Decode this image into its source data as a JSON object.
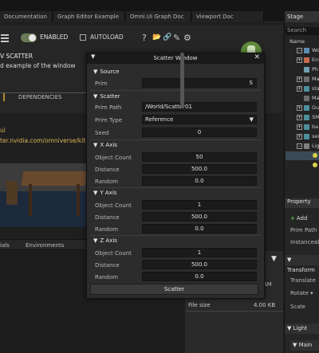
{
  "tabs": [
    {
      "label": "Documentation",
      "active": false
    },
    {
      "label": "Graph Editor Example",
      "active": false
    },
    {
      "label": "Omni.UI Graph Doc",
      "active": false
    },
    {
      "label": "Viewport Doc",
      "active": false
    },
    {
      "label": "Stage",
      "active": true
    }
  ],
  "toolbar": {
    "enabled_label": "ENABLED",
    "enabled_state": true,
    "autoload_label": "AUTOLOAD",
    "autoload_checked": false,
    "help_icon": "?",
    "folder_icon": "📂",
    "link_icon": "🔗",
    "edit_icon": "✎",
    "settings_icon": "⚙"
  },
  "extension": {
    "title": "V SCATTER",
    "description": "d example of the window",
    "dependencies_tab": "DEPENDENCIES",
    "pa_tab": "PA",
    "ui_label": "ui",
    "url": "ter.nvidia.com/omniverse/kit-ext"
  },
  "bottom_tabs": [
    "ials",
    "Environments"
  ],
  "file_info": {
    "label": "File size",
    "value": "4.00 KB",
    "am_label": "AM"
  },
  "stage": {
    "search": "Search",
    "column_name": "Name",
    "rows": [
      {
        "label": "World",
        "expander": "–",
        "icon_color": "#5a8db0",
        "selected": false
      },
      {
        "label": "Env",
        "expander": "+",
        "icon_color": "#c36c4e",
        "selected": false
      },
      {
        "label": "Ph",
        "expander": "",
        "icon_color": "#6fa0b0",
        "selected": false
      },
      {
        "label": "Ma",
        "expander": "+",
        "icon_color": "#6b6b6b",
        "selected": false
      },
      {
        "label": "sta",
        "expander": "+",
        "icon_color": "#4d8e9a",
        "selected": false
      },
      {
        "label": "Ma",
        "expander": "",
        "icon_color": "#6b6b6b",
        "selected": false
      },
      {
        "label": "Gu",
        "expander": "+",
        "icon_color": "#4d8e9a",
        "selected": false
      },
      {
        "label": "SM",
        "expander": "+",
        "icon_color": "#4d8e9a",
        "selected": false
      },
      {
        "label": "ba",
        "expander": "+",
        "icon_color": "#4d8e9a",
        "selected": false
      },
      {
        "label": "ser",
        "expander": "+",
        "icon_color": "#4d8e9a",
        "selected": false
      },
      {
        "label": "Lig",
        "expander": "–",
        "icon_color": "#7f7f7f",
        "selected": false
      },
      {
        "label": "",
        "expander": "",
        "icon_color": "",
        "selected": true
      }
    ]
  },
  "property": {
    "tab": "Property",
    "add_label": "Add",
    "prim_path_label": "Prim Path",
    "instanceable_label": "Instanceab",
    "transform_section": "Transform",
    "translate_label": "Translate",
    "rotate_label": "Rotate ▾",
    "scale_label": "Scale",
    "light_section": "Light",
    "main_section": "Main"
  },
  "scatter_window": {
    "title": "Scatter Window",
    "source": {
      "section": "Source",
      "prim_label": "Prim",
      "prim_value": "S"
    },
    "scatter": {
      "section": "Scatter",
      "prim_path_label": "Prim Path",
      "prim_path_value": "/World/Scatter01",
      "prim_type_label": "Prim Type",
      "prim_type_value": "Reference",
      "seed_label": "Seed",
      "seed_value": "0"
    },
    "x_axis": {
      "section": "X Axis",
      "object_count_label": "Object Count",
      "object_count_value": "50",
      "distance_label": "Distance",
      "distance_value": "500.0",
      "random_label": "Random",
      "random_value": "0.0"
    },
    "y_axis": {
      "section": "Y Axis",
      "object_count_label": "Object Count",
      "object_count_value": "1",
      "distance_label": "Distance",
      "distance_value": "500.0",
      "random_label": "Random",
      "random_value": "0.0"
    },
    "z_axis": {
      "section": "Z Axis",
      "object_count_label": "Object Count",
      "object_count_value": "1",
      "distance_label": "Distance",
      "distance_value": "500.0",
      "random_label": "Random",
      "random_value": "0.0"
    },
    "scatter_button": "Scatter",
    "close_icon": "✕",
    "collapse_icon": "▼"
  }
}
